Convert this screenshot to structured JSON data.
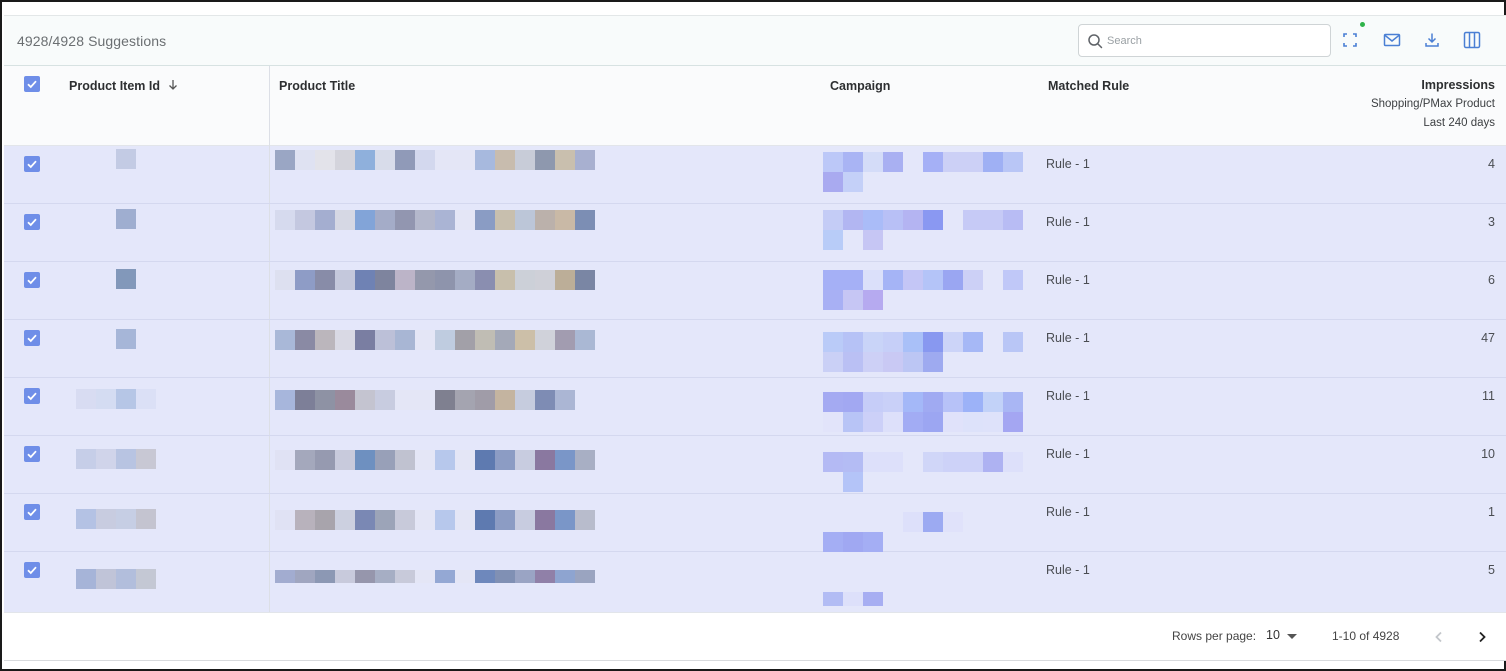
{
  "toolbar": {
    "suggestion_count": "4928/4928 Suggestions",
    "search_placeholder": "Search",
    "icons": [
      "fullscreen-icon",
      "mail-icon",
      "download-icon",
      "columns-icon"
    ],
    "status_dot_color": "#2fb34a"
  },
  "table": {
    "columns": {
      "product_item_id": "Product Item Id",
      "product_title": "Product Title",
      "campaign": "Campaign",
      "matched_rule": "Matched Rule",
      "impressions": "Impressions",
      "impressions_sub1": "Shopping/PMax Product",
      "impressions_sub2": "Last 240 days"
    },
    "sort_icon": "arrow-down-icon",
    "select_all_checked": true,
    "rows": [
      {
        "checked": true,
        "matched_rule": "Rule - 1",
        "impressions": "4"
      },
      {
        "checked": true,
        "matched_rule": "Rule - 1",
        "impressions": "3"
      },
      {
        "checked": true,
        "matched_rule": "Rule - 1",
        "impressions": "6"
      },
      {
        "checked": true,
        "matched_rule": "Rule - 1",
        "impressions": "47"
      },
      {
        "checked": true,
        "matched_rule": "Rule - 1",
        "impressions": "11"
      },
      {
        "checked": true,
        "matched_rule": "Rule - 1",
        "impressions": "10"
      },
      {
        "checked": true,
        "matched_rule": "Rule - 1",
        "impressions": "1"
      },
      {
        "checked": true,
        "matched_rule": "Rule - 1",
        "impressions": "5"
      }
    ]
  },
  "pagination": {
    "rows_per_page_label": "Rows per page:",
    "rows_per_page_value": "10",
    "range_text": "1-10 of 4928"
  },
  "colors": {
    "row_bg": "#e4e7fa",
    "checkbox": "#6f8ee8"
  }
}
